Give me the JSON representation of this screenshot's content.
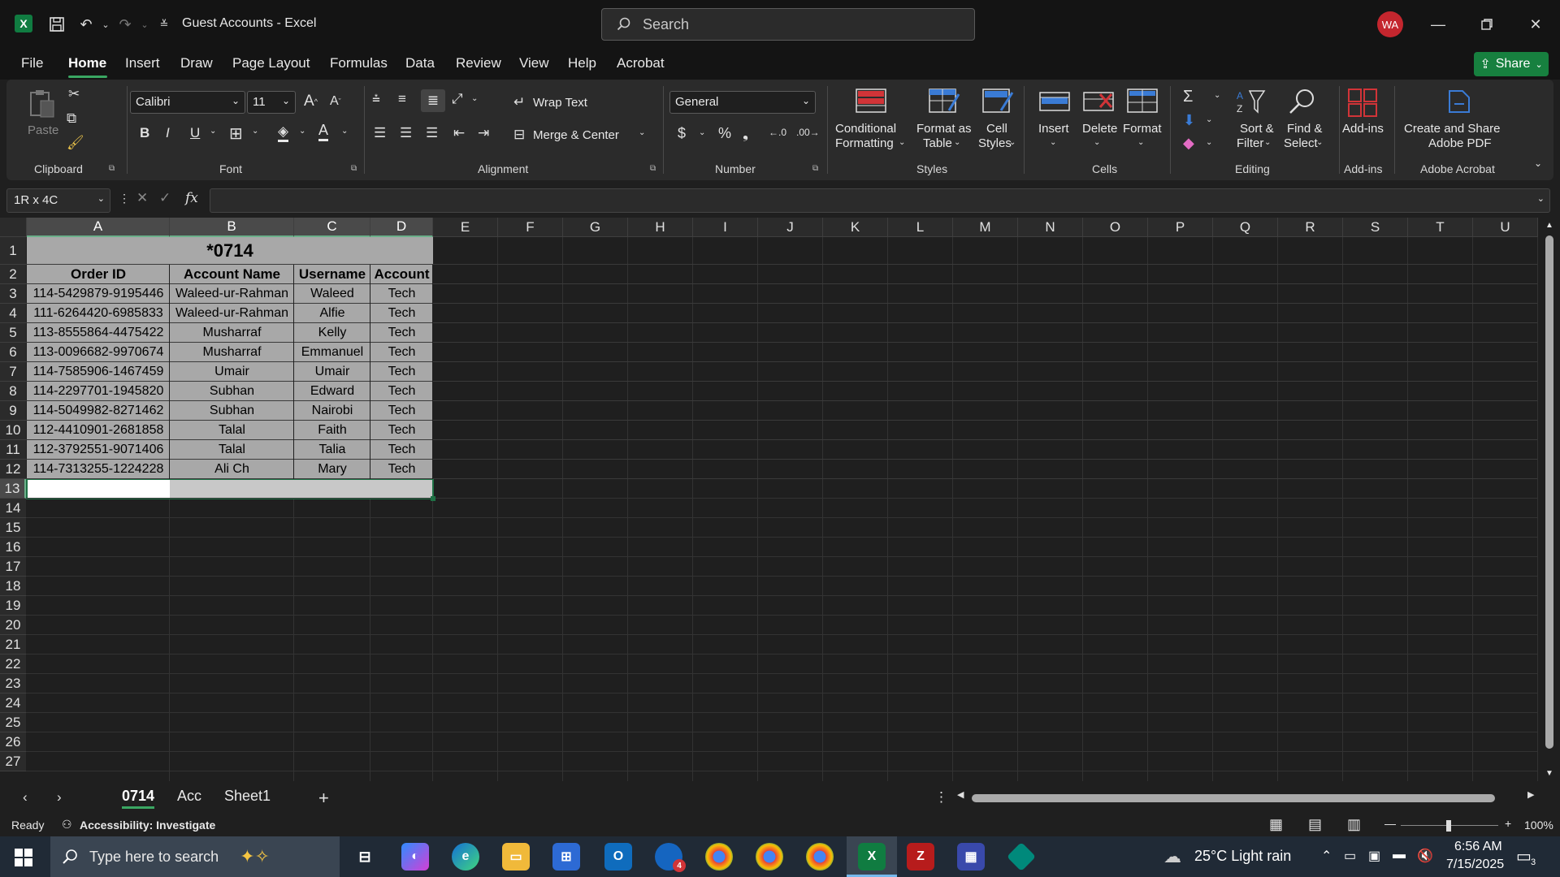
{
  "window": {
    "title": "Guest Accounts  -  Excel",
    "search_placeholder": "Search",
    "avatar_initials": "WA"
  },
  "menu": {
    "tabs": [
      "File",
      "Home",
      "Insert",
      "Draw",
      "Page Layout",
      "Formulas",
      "Data",
      "Review",
      "View",
      "Help",
      "Acrobat"
    ],
    "active": "Home",
    "share_label": "Share"
  },
  "ribbon": {
    "clipboard": {
      "paste": "Paste",
      "label": "Clipboard"
    },
    "font": {
      "name": "Calibri",
      "size": "11",
      "label": "Font",
      "bold": "B",
      "italic": "I",
      "underline": "U"
    },
    "alignment": {
      "wrap_text": "Wrap Text",
      "merge_center": "Merge & Center",
      "label": "Alignment"
    },
    "number": {
      "format": "General",
      "label": "Number"
    },
    "styles": {
      "conditional_1": "Conditional",
      "conditional_2": "Formatting",
      "format_table_1": "Format as",
      "format_table_2": "Table",
      "cell_styles_1": "Cell",
      "cell_styles_2": "Styles",
      "label": "Styles"
    },
    "cells": {
      "insert": "Insert",
      "delete": "Delete",
      "format": "Format",
      "label": "Cells"
    },
    "editing": {
      "sort_1": "Sort &",
      "sort_2": "Filter",
      "find_1": "Find &",
      "find_2": "Select",
      "label": "Editing"
    },
    "addins": {
      "addins": "Add-ins",
      "label": "Add-ins"
    },
    "acrobat": {
      "create_1": "Create and Share",
      "create_2": "Adobe PDF",
      "label": "Adobe Acrobat"
    }
  },
  "formula_bar": {
    "name_box": "1R x 4C",
    "fx": "fx",
    "content": ""
  },
  "columns": [
    "A",
    "B",
    "C",
    "D",
    "E",
    "F",
    "G",
    "H",
    "I",
    "J",
    "K",
    "L",
    "M",
    "N",
    "O",
    "P",
    "Q",
    "R",
    "S",
    "T",
    "U"
  ],
  "rows": [
    "1",
    "2",
    "3",
    "4",
    "5",
    "6",
    "7",
    "8",
    "9",
    "10",
    "11",
    "12",
    "13",
    "14",
    "15",
    "16",
    "17",
    "18",
    "19",
    "20",
    "21",
    "22",
    "23",
    "24",
    "25",
    "26",
    "27"
  ],
  "sheet": {
    "title": "*0714",
    "headers": [
      "Order ID",
      "Account Name",
      "Username",
      "Account"
    ],
    "data": [
      [
        "114-5429879-9195446",
        "Waleed-ur-Rahman",
        "Waleed",
        "Tech"
      ],
      [
        "111-6264420-6985833",
        "Waleed-ur-Rahman",
        "Alfie",
        "Tech"
      ],
      [
        "113-8555864-4475422",
        "Musharraf",
        "Kelly",
        "Tech"
      ],
      [
        "113-0096682-9970674",
        "Musharraf",
        "Emmanuel",
        "Tech"
      ],
      [
        "114-7585906-1467459",
        "Umair",
        "Umair",
        "Tech"
      ],
      [
        "114-2297701-1945820",
        "Subhan",
        "Edward",
        "Tech"
      ],
      [
        "114-5049982-8271462",
        "Subhan",
        "Nairobi",
        "Tech"
      ],
      [
        "112-4410901-2681858",
        "Talal",
        "Faith",
        "Tech"
      ],
      [
        "112-3792551-9071406",
        "Talal",
        "Talia",
        "Tech"
      ],
      [
        "114-7313255-1224228",
        "Ali Ch",
        "Mary",
        "Tech"
      ]
    ]
  },
  "sheet_tabs": [
    "0714",
    "Acc",
    "Sheet1"
  ],
  "active_sheet": "0714",
  "status": {
    "ready": "Ready",
    "accessibility": "Accessibility: Investigate",
    "zoom": "100%"
  },
  "taskbar": {
    "search_placeholder": "Type here to search",
    "weather": "25°C  Light rain",
    "time": "6:56 AM",
    "date": "7/15/2025",
    "notification_count": "3",
    "outlook_badge": "4"
  },
  "colors": {
    "accent": "#107c41",
    "share": "#17803f",
    "table_fill": "#a8a8a8"
  }
}
